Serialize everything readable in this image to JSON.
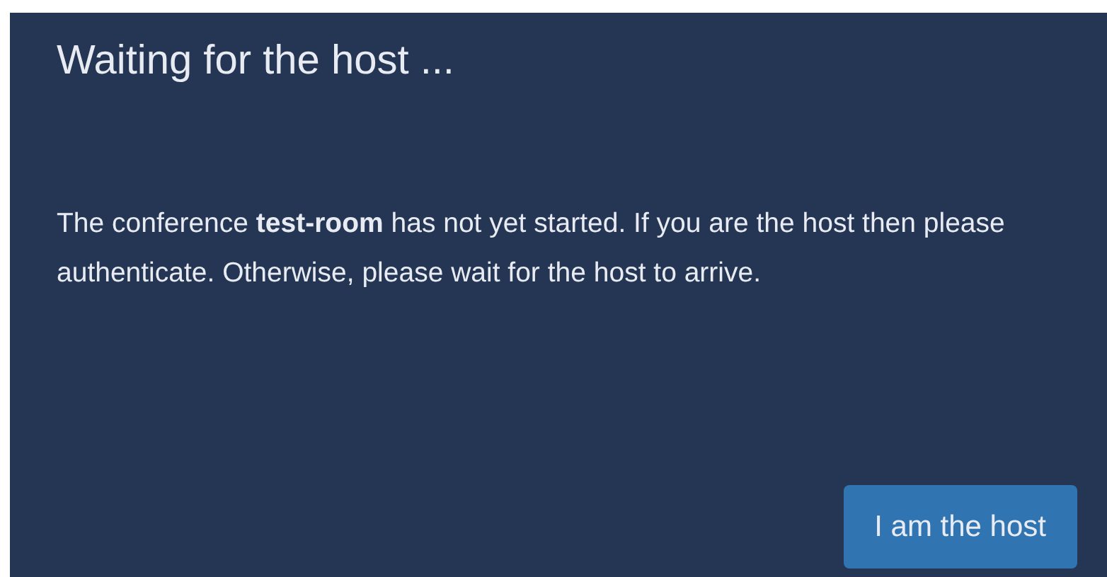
{
  "dialog": {
    "title": "Waiting for the host ...",
    "message": "The conference **test-room** has not yet started. If you are the host then please authenticate. Otherwise, please wait for the host to arrive.",
    "buttons": [
      "I am the host"
    ]
  }
}
